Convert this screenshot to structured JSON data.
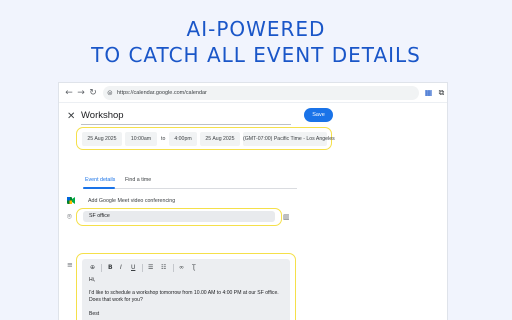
{
  "promo": {
    "line1": "AI-POWERED",
    "line2": "TO CATCH ALL EVENT DETAILS"
  },
  "browser": {
    "url": "https://calendar.google.com/calendar",
    "icons": [
      "back-arrow-icon",
      "forward-arrow-icon",
      "reload-icon",
      "site-settings-icon",
      "extension-calendar-icon",
      "extension-puzzle-icon"
    ]
  },
  "event": {
    "title": "Workshop",
    "save_label": "Save",
    "start_date": "25 Aug 2025",
    "start_time": "10:00am",
    "to_label": "to",
    "end_time": "4:00pm",
    "end_date": "25 Aug 2025",
    "timezone": "(GMT-07:00) Pacific Time - Los Angeles"
  },
  "tabs": [
    {
      "label": "Event details",
      "active": true
    },
    {
      "label": "Find a time",
      "active": false
    }
  ],
  "meet": {
    "label": "Add Google Meet video conferencing"
  },
  "location": {
    "value": "SF office"
  },
  "description": {
    "toolbar": [
      "attach-icon",
      "bold-icon",
      "italic-icon",
      "underline-icon",
      "numbered-list-icon",
      "bulleted-list-icon",
      "link-icon",
      "clear-format-icon"
    ],
    "lines": [
      "Hi,",
      "I'd like to schedule a workshop tomorrow from 10.00 AM to 4:00 PM at our SF office.",
      "Does that work for you?",
      "Best"
    ]
  },
  "colors": {
    "accent": "#1a73e8",
    "headline": "#1a56c8",
    "highlight": "#f5e04a",
    "background": "#f1f4fd"
  }
}
